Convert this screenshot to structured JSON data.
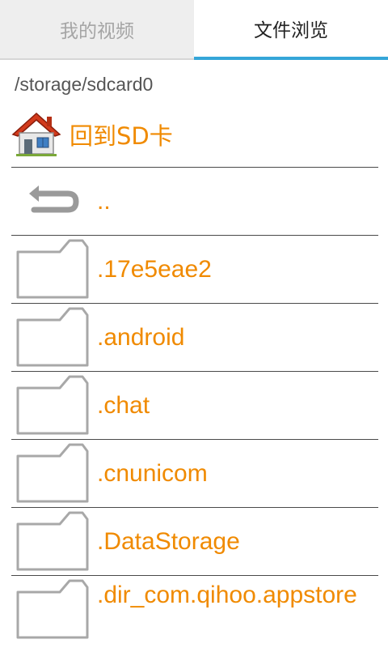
{
  "tabs": [
    {
      "label": "我的视频",
      "active": false
    },
    {
      "label": "文件浏览",
      "active": true
    }
  ],
  "current_path": "/storage/sdcard0",
  "home": {
    "label": "回到SD卡",
    "icon": "house-icon"
  },
  "entries": [
    {
      "label": "..",
      "icon": "back-arrow-icon"
    },
    {
      "label": ".17e5eae2",
      "icon": "folder-icon"
    },
    {
      "label": ".android",
      "icon": "folder-icon"
    },
    {
      "label": ".chat",
      "icon": "folder-icon"
    },
    {
      "label": ".cnunicom",
      "icon": "folder-icon"
    },
    {
      "label": ".DataStorage",
      "icon": "folder-icon"
    },
    {
      "label": ".dir_com.qihoo.appstore",
      "icon": "folder-icon"
    }
  ],
  "colors": {
    "accent": "#35a6d8",
    "label_orange": "#f08a00",
    "divider": "#4a4a4a"
  }
}
